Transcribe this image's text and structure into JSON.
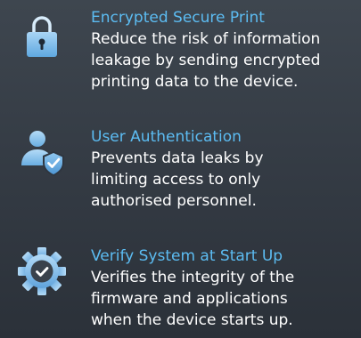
{
  "features": [
    {
      "icon": "padlock-icon",
      "title": "Encrypted Secure Print",
      "description_lines": [
        "Reduce the risk of information",
        "leakage by sending encrypted",
        "printing data to the device."
      ]
    },
    {
      "icon": "user-shield-check-icon",
      "title": "User Authentication",
      "description_lines": [
        "Prevents data leaks by",
        "limiting access to only",
        "authorised personnel."
      ]
    },
    {
      "icon": "gear-check-icon",
      "title": "Verify System at Start Up",
      "description_lines": [
        "Verifies the integrity of the",
        "firmware and applications",
        "when the device starts up."
      ]
    }
  ],
  "colors": {
    "background_top": "#3e464f",
    "background_bottom": "#2b3139",
    "title_blue": "#5cbcf2",
    "description_white": "#ffffff",
    "icon_blue": "#7ab8e8"
  }
}
